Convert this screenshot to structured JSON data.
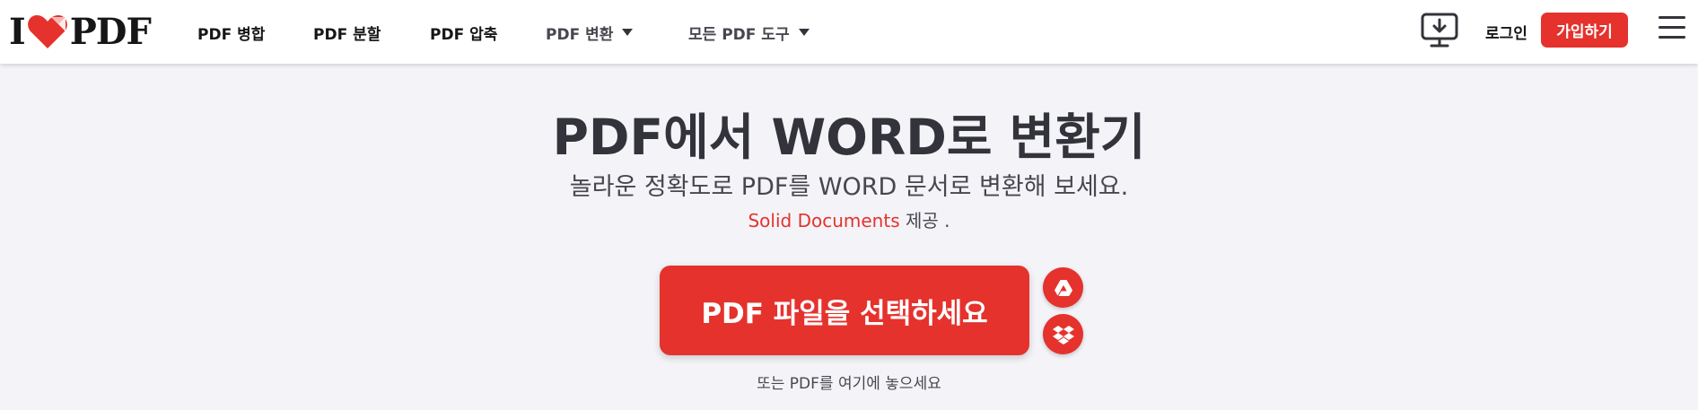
{
  "header": {
    "logo": {
      "left": "I",
      "right": "PDF"
    },
    "nav": [
      {
        "label": "PDF 병합"
      },
      {
        "label": "PDF 분할"
      },
      {
        "label": "PDF 압축"
      },
      {
        "label": "PDF 변환"
      },
      {
        "label": "모든 PDF 도구"
      }
    ],
    "login_label": "로그인",
    "signup_label": "가입하기",
    "icons": {
      "desktop": "desktop-download-icon",
      "menu": "hamburger-menu-icon"
    }
  },
  "main": {
    "title": "PDF에서 WORD로 변환기",
    "subtitle": "놀라운 정확도로 PDF를 WORD 문서로 변환해 보세요.",
    "provider_link": "Solid Documents",
    "provider_suffix": "제공 .",
    "select_button": "PDF 파일을 선택하세요",
    "drop_hint": "또는 PDF를 여기에 놓으세요",
    "cloud_icons": [
      "google-drive-icon",
      "dropbox-icon"
    ]
  },
  "colors": {
    "brand_red": "#e5322d",
    "page_bg": "#f4f4f8",
    "text_dark": "#33333b"
  }
}
